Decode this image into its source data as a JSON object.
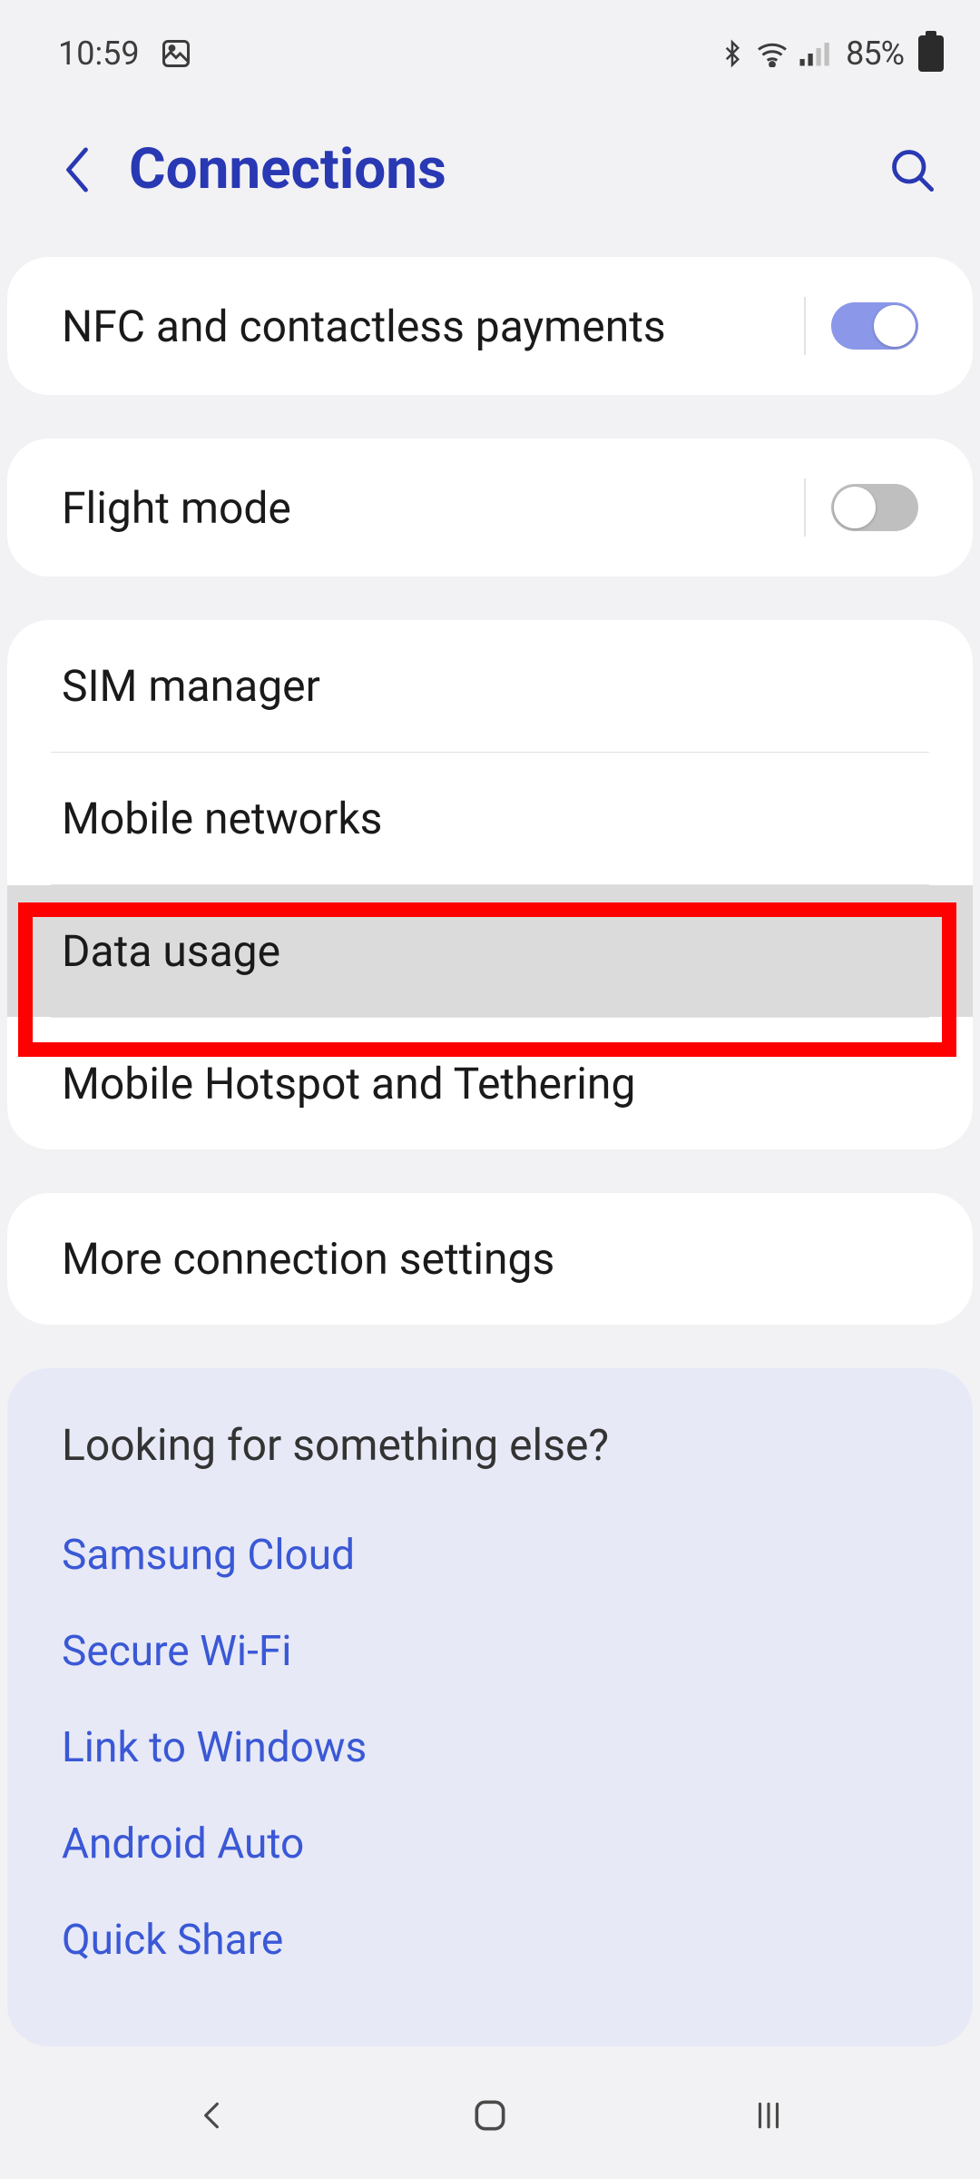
{
  "status": {
    "time": "10:59",
    "icons": {
      "picture": "picture-icon",
      "bluetooth": "bluetooth-icon",
      "wifi": "wifi-icon",
      "signal": "signal-icon"
    },
    "battery_pct": "85%"
  },
  "header": {
    "title": "Connections"
  },
  "groups": [
    {
      "rows": [
        {
          "key": "nfc",
          "label": "NFC and contactless payments",
          "toggle": true,
          "on": true
        }
      ]
    },
    {
      "rows": [
        {
          "key": "flight-mode",
          "label": "Flight mode",
          "toggle": true,
          "on": false
        }
      ]
    },
    {
      "rows": [
        {
          "key": "sim-manager",
          "label": "SIM manager"
        },
        {
          "key": "mobile-networks",
          "label": "Mobile networks"
        },
        {
          "key": "data-usage",
          "label": "Data usage",
          "highlighted": true
        },
        {
          "key": "hotspot-tethering",
          "label": "Mobile Hotspot and Tethering"
        }
      ]
    },
    {
      "rows": [
        {
          "key": "more-connection",
          "label": "More connection settings"
        }
      ]
    }
  ],
  "suggestions": {
    "title": "Looking for something else?",
    "links": [
      "Samsung Cloud",
      "Secure Wi-Fi",
      "Link to Windows",
      "Android Auto",
      "Quick Share"
    ]
  },
  "colors": {
    "accent": "#2938b3",
    "link": "#3a58d6",
    "toggle_on": "#8b97e8",
    "highlight_border": "#ff0000"
  }
}
